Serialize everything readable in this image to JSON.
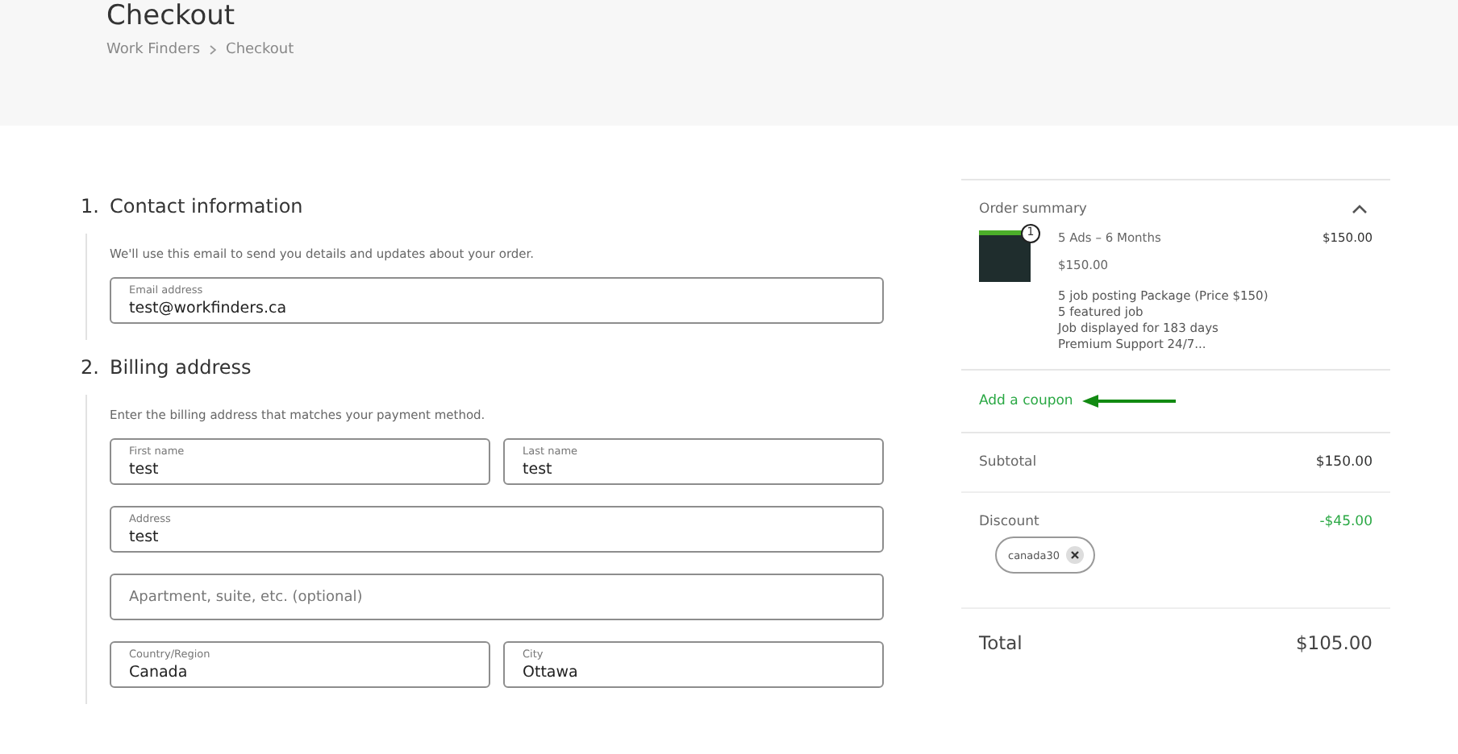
{
  "header": {
    "title": "Checkout",
    "breadcrumb": [
      "Work Finders",
      "Checkout"
    ]
  },
  "sections": [
    {
      "number": "1.",
      "title": "Contact information",
      "description": "We'll use this email to send you details and updates about your order.",
      "rows": [
        [
          {
            "label": "Email address",
            "value": "test@workfinders.ca"
          }
        ]
      ]
    },
    {
      "number": "2.",
      "title": "Billing address",
      "description": "Enter the billing address that matches your payment method.",
      "rows": [
        [
          {
            "label": "First name",
            "value": "test"
          },
          {
            "label": "Last name",
            "value": "test"
          }
        ],
        [
          {
            "label": "Address",
            "value": "test"
          }
        ],
        [
          {
            "placeholder": "Apartment, suite, etc. (optional)"
          }
        ],
        [
          {
            "label": "Country/Region",
            "value": "Canada"
          },
          {
            "label": "City",
            "value": "Ottawa"
          }
        ]
      ]
    }
  ],
  "summary": {
    "title": "Order summary",
    "expanded": true,
    "item": {
      "quantity": "1",
      "name": "5 Ads – 6 Months",
      "price": "$150.00",
      "unit_price": "$150.00",
      "details": [
        "5 job posting Package (Price $150)",
        "5 featured job",
        "Job displayed for 183 days",
        "Premium Support 24/7..."
      ]
    },
    "coupon_link": "Add a coupon",
    "subtotal": {
      "label": "Subtotal",
      "value": "$150.00"
    },
    "discount": {
      "label": "Discount",
      "value": "-$45.00",
      "coupon": "canada30"
    },
    "total": {
      "label": "Total",
      "value": "$105.00"
    }
  }
}
